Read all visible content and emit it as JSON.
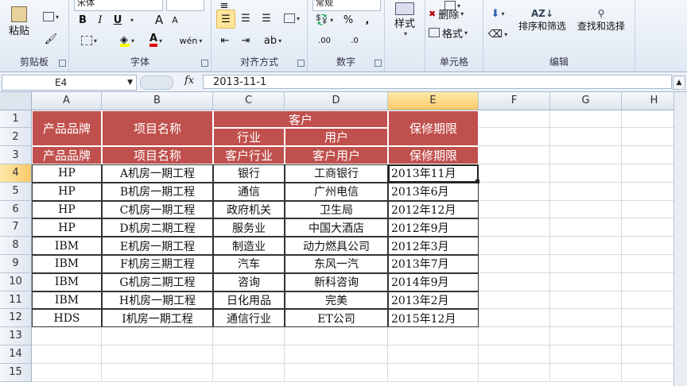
{
  "ribbon": {
    "clipboard": {
      "paste": "粘贴",
      "label": "剪贴板"
    },
    "font": {
      "name": "宋体",
      "bold": "B",
      "italic": "I",
      "underline": "U",
      "grow": "A",
      "shrink": "A",
      "label": "字体"
    },
    "alignment": {
      "label": "对齐方式"
    },
    "number": {
      "format": "常规",
      "percent": "%",
      "comma": ",",
      "inc_decimal": ".00",
      "dec_decimal": ".0",
      "label": "数字"
    },
    "styles": {
      "label": "样式"
    },
    "cells": {
      "delete": "删除",
      "format": "格式",
      "label": "单元格"
    },
    "editing": {
      "sort_filter": "排序和筛选",
      "find_select": "查找和选择",
      "label": "编辑"
    }
  },
  "formula_bar": {
    "name_box": "E4",
    "fx": "fx",
    "formula": "2013-11-1"
  },
  "columns": [
    "A",
    "B",
    "C",
    "D",
    "E",
    "F",
    "G",
    "H"
  ],
  "rows": [
    "1",
    "2",
    "3",
    "4",
    "5",
    "6",
    "7",
    "8",
    "9",
    "10",
    "11",
    "12",
    "13",
    "14",
    "15"
  ],
  "active": {
    "column": "E",
    "row": "4"
  },
  "header": {
    "brand": "产品品牌",
    "project": "项目名称",
    "customer": "客户",
    "industry": "行业",
    "user": "用户",
    "warranty": "保修期限"
  },
  "header_row3": [
    "产品品牌",
    "项目名称",
    "客户行业",
    "客户用户",
    "保修期限"
  ],
  "table": [
    [
      "HP",
      "A机房一期工程",
      "银行",
      "工商银行",
      "2013年11月"
    ],
    [
      "HP",
      "B机房一期工程",
      "通信",
      "广州电信",
      "2013年6月"
    ],
    [
      "HP",
      "C机房一期工程",
      "政府机关",
      "卫生局",
      "2012年12月"
    ],
    [
      "HP",
      "D机房二期工程",
      "服务业",
      "中国大酒店",
      "2012年9月"
    ],
    [
      "IBM",
      "E机房一期工程",
      "制造业",
      "动力燃具公司",
      "2012年3月"
    ],
    [
      "IBM",
      "F机房三期工程",
      "汽车",
      "东风一汽",
      "2013年7月"
    ],
    [
      "IBM",
      "G机房二期工程",
      "咨询",
      "新科咨询",
      "2014年9月"
    ],
    [
      "IBM",
      "H机房一期工程",
      "日化用品",
      "完美",
      "2013年2月"
    ],
    [
      "HDS",
      "I机房一期工程",
      "通信行业",
      "ET公司",
      "2015年12月"
    ]
  ],
  "colors": {
    "header_fill": "#c0504d",
    "header_text": "#ffffff",
    "selection": "#222222"
  }
}
